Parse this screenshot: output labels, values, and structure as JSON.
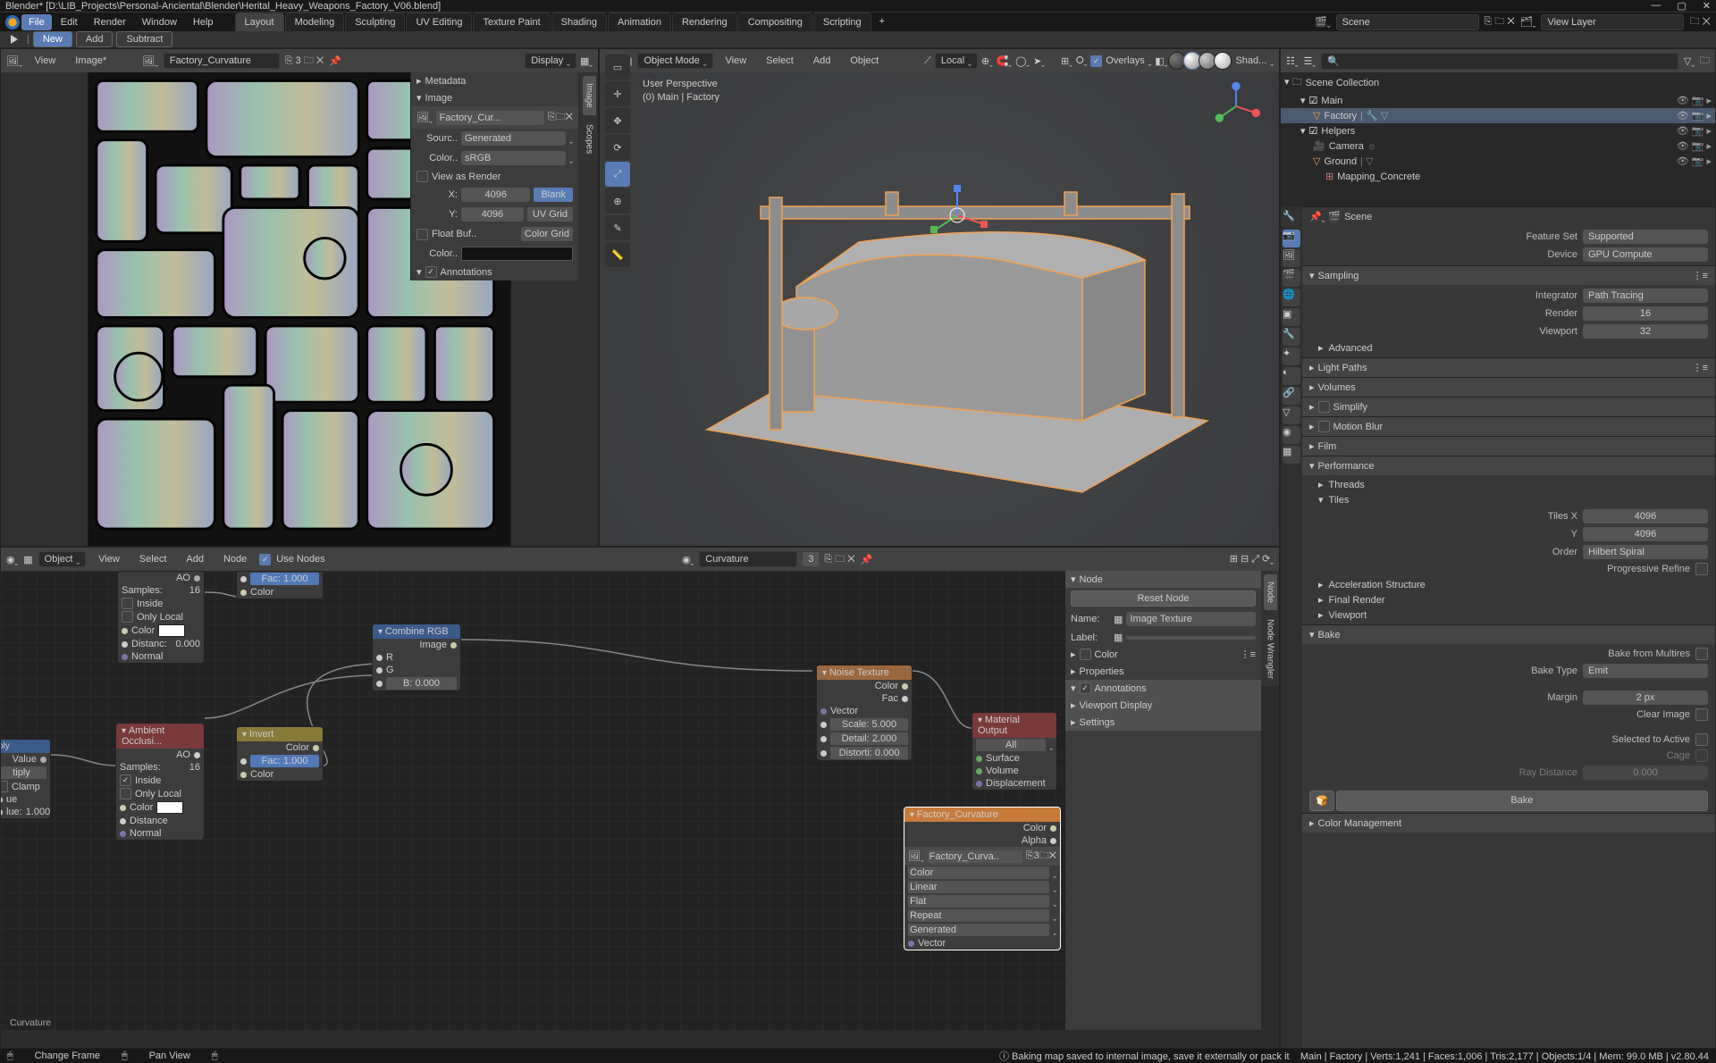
{
  "titlebar": {
    "title": "Blender* [D:\\LIB_Projects\\Personal-Anciental\\Blender\\Herital_Heavy_Weapons_Factory_V06.blend]"
  },
  "menu": {
    "file": "File",
    "edit": "Edit",
    "render": "Render",
    "window": "Window",
    "help": "Help"
  },
  "workspaces": [
    "Layout",
    "Modeling",
    "Sculpting",
    "UV Editing",
    "Texture Paint",
    "Shading",
    "Animation",
    "Rendering",
    "Compositing",
    "Scripting"
  ],
  "active_ws": "Layout",
  "scene_sel": {
    "scene": "Scene",
    "viewlayer": "View Layer"
  },
  "opbar": {
    "new": "New",
    "add": "Add",
    "subtract": "Subtract"
  },
  "uv": {
    "menus": [
      "View",
      "Image*"
    ],
    "imgname": "Factory_Curvature",
    "display": "Display",
    "props": {
      "header": "Factory_Cur...",
      "meta": "Metadata",
      "image": "Image",
      "source_k": "Sourc..",
      "source_v": "Generated",
      "color_k": "Color..",
      "color_v": "sRGB",
      "view_as": "View as Render",
      "x_k": "X:",
      "x_v": "4096",
      "y_k": "Y:",
      "y_v": "4096",
      "float": "Float Buf..",
      "blank": "Blank",
      "uvgrid": "UV Grid",
      "colorgrid": "Color Grid",
      "colork": "Color..",
      "annot": "Annotations"
    }
  },
  "vp": {
    "mode": "Object Mode",
    "menus": [
      "View",
      "Select",
      "Add",
      "Object"
    ],
    "orient": "Local",
    "overlays": "Overlays",
    "shad": "Shad...",
    "overlay0": "User Perspective",
    "overlay1": "(0) Main | Factory"
  },
  "outliner": {
    "root": "Scene Collection",
    "main": "Main",
    "factory": "Factory",
    "helpers": "Helpers",
    "camera": "Camera",
    "ground": "Ground",
    "mapping": "Mapping_Concrete"
  },
  "props": {
    "scene_hdr": "Scene",
    "feat_k": "Feature Set",
    "feat_v": "Supported",
    "dev_k": "Device",
    "dev_v": "GPU Compute",
    "sampling": "Sampling",
    "integ_k": "Integrator",
    "integ_v": "Path Tracing",
    "rend_k": "Render",
    "rend_v": "16",
    "view_k": "Viewport",
    "view_v": "32",
    "advanced": "Advanced",
    "light": "Light Paths",
    "volumes": "Volumes",
    "simplify": "Simplify",
    "motion": "Motion Blur",
    "film": "Film",
    "perf": "Performance",
    "threads": "Threads",
    "tiles": "Tiles",
    "tx_k": "Tiles X",
    "tx_v": "4096",
    "ty_k": "Y",
    "ty_v": "4096",
    "order_k": "Order",
    "order_v": "Hilbert Spiral",
    "prog": "Progressive Refine",
    "accel": "Acceleration Structure",
    "final": "Final Render",
    "viewport": "Viewport",
    "bake": "Bake",
    "bakemulti": "Bake from Multires",
    "baketype_k": "Bake Type",
    "baketype_v": "Emit",
    "margin_k": "Margin",
    "margin_v": "2 px",
    "clear": "Clear Image",
    "sel2act": "Selected to Active",
    "cage": "Cage",
    "raydist_k": "Ray Distance",
    "raydist_v": "0.000",
    "bakebtn": "Bake",
    "colmgmt": "Color Management"
  },
  "nodes": {
    "menus": [
      "View",
      "Select",
      "Add",
      "Node"
    ],
    "object": "Object",
    "usenodes": "Use Nodes",
    "material": "Curvature",
    "matusers": "3",
    "side": {
      "node": "Node",
      "reset": "Reset Node",
      "name_k": "Name:",
      "name_v": "Image Texture",
      "label_k": "Label:",
      "color": "Color",
      "props": "Properties",
      "annot": "Annotations",
      "vdisp": "Viewport Display",
      "settings": "Settings"
    },
    "breadcrumb": "Curvature",
    "ao1": {
      "hdr": "",
      "ao": "AO",
      "samples_k": "Samples:",
      "samples_v": "16",
      "inside": "Inside",
      "only": "Only Local",
      "color": "Color",
      "dist_k": "Distanc:",
      "dist_v": "0.000",
      "normal": "Normal",
      "fac": "Fac:",
      "facv": "1.000",
      "ncolor": "Color"
    },
    "ao2": {
      "hdr": "Ambient Occlusi...",
      "ao": "AO",
      "samples_k": "Samples:",
      "samples_v": "16",
      "inside": "Inside",
      "only": "Only Local",
      "color": "Color",
      "dist": "Distance",
      "normal": "Normal"
    },
    "mult": {
      "ply": "ply",
      "value": "Value",
      "tiply": "tiply",
      "clamp": "Clamp",
      "ue": "ue",
      "lue_k": "lue:",
      "lue_v": "1.000"
    },
    "invert": {
      "hdr": "Invert",
      "fac": "Fac:",
      "facv": "1.000",
      "color": "Color",
      "ocolor": "Color"
    },
    "combine": {
      "hdr": "Combine RGB",
      "image": "Image",
      "r": "R",
      "g": "G",
      "b_k": "B:",
      "b_v": "0.000"
    },
    "noise": {
      "hdr": "Noise Texture",
      "color": "Color",
      "fac": "Fac",
      "vector": "Vector",
      "scale_k": "Scale:",
      "scale_v": "5.000",
      "detail_k": "Detail:",
      "detail_v": "2.000",
      "dist_k": "Distorti:",
      "dist_v": "0.000"
    },
    "matout": {
      "hdr": "Material Output",
      "all": "All",
      "surf": "Surface",
      "vol": "Volume",
      "disp": "Displacement"
    },
    "imgtex": {
      "hdr": "Factory_Curvature",
      "color": "Color",
      "alpha": "Alpha",
      "img": "Factory_Curva..",
      "csp": "Color",
      "interp": "Linear",
      "proj": "Flat",
      "ext": "Repeat",
      "src": "Generated",
      "vector": "Vector"
    }
  },
  "statusbar": {
    "l1": "Change Frame",
    "l2": "Pan View",
    "msg": "Baking map saved to internal image, save it externally or pack it",
    "stats": "Main | Factory | Verts:1,241 | Faces:1,006 | Tris:2,177 | Objects:1/4 | Mem: 99.0 MB | v2.80.44"
  }
}
